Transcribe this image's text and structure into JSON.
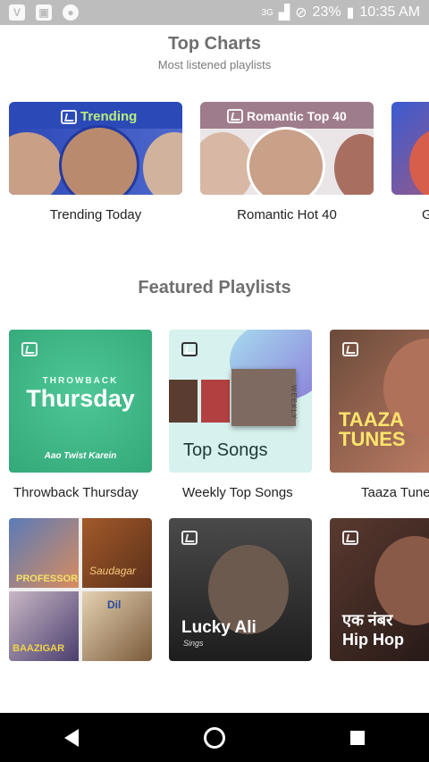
{
  "status": {
    "battery": "23%",
    "time": "10:35 AM",
    "signal": "3G"
  },
  "top_charts": {
    "title": "Top Charts",
    "subtitle": "Most listened playlists",
    "cards": [
      {
        "badge": "Trending",
        "label": "Trending Today"
      },
      {
        "badge": "Romantic Top 40",
        "label": "Romantic Hot 40"
      },
      {
        "badge": "",
        "label": "G"
      }
    ]
  },
  "featured": {
    "title": "Featured Playlists",
    "tiles": [
      {
        "kicker": "THROWBACK",
        "headline": "Thursday",
        "tagline": "Aao Twist Karein",
        "label": "Throwback Thursday"
      },
      {
        "headline": "Top Songs",
        "side": "WEEKLY",
        "label": "Weekly Top Songs"
      },
      {
        "headline": "TAAZA TUNES",
        "label": "Taaza Tune"
      }
    ],
    "tiles_row2": [
      {
        "poster_texts": [
          "PROFESSOR",
          "Saudagar",
          "BAAZIGAR",
          "Dil"
        ]
      },
      {
        "headline": "Lucky Ali",
        "sub": "Sings"
      },
      {
        "headline": "एक नंबर",
        "sub": "Hip Hop"
      }
    ]
  },
  "colors": {
    "accent_trending": "#2c49b8",
    "accent_romantic": "#9f7c8c",
    "throwback_green": "#3fb283",
    "weekly_bg": "#d7f1ee"
  }
}
